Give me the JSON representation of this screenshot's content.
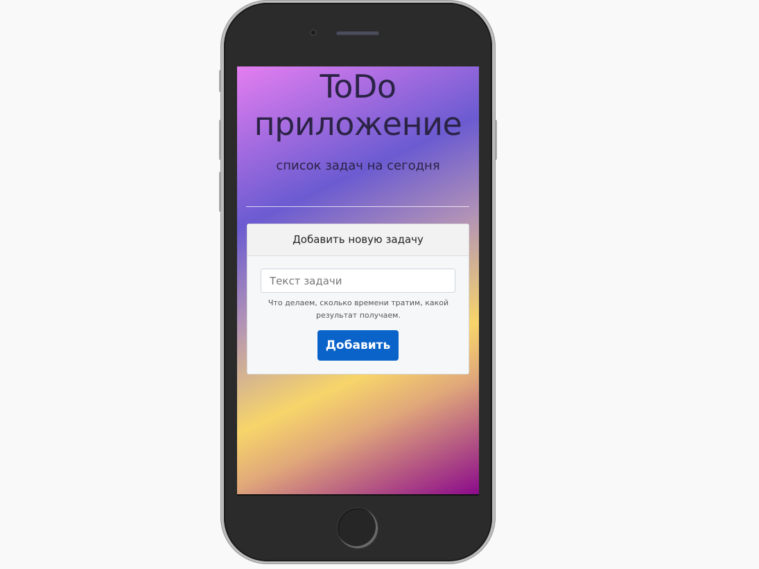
{
  "app": {
    "title": "ToDo приложение",
    "subtitle": "список задач на сегодня"
  },
  "form": {
    "header": "Добавить новую задачу",
    "input_placeholder": "Текст задачи",
    "input_value": "",
    "help_text": "Что делаем, сколько времени тратим, какой результат получаем.",
    "submit_label": "Добавить"
  },
  "colors": {
    "button": "#0a63c9",
    "title_text": "#2b2346",
    "gradient": [
      "#e47ef0",
      "#6b5bd1",
      "#f7d56a",
      "#8b0a8b"
    ]
  }
}
